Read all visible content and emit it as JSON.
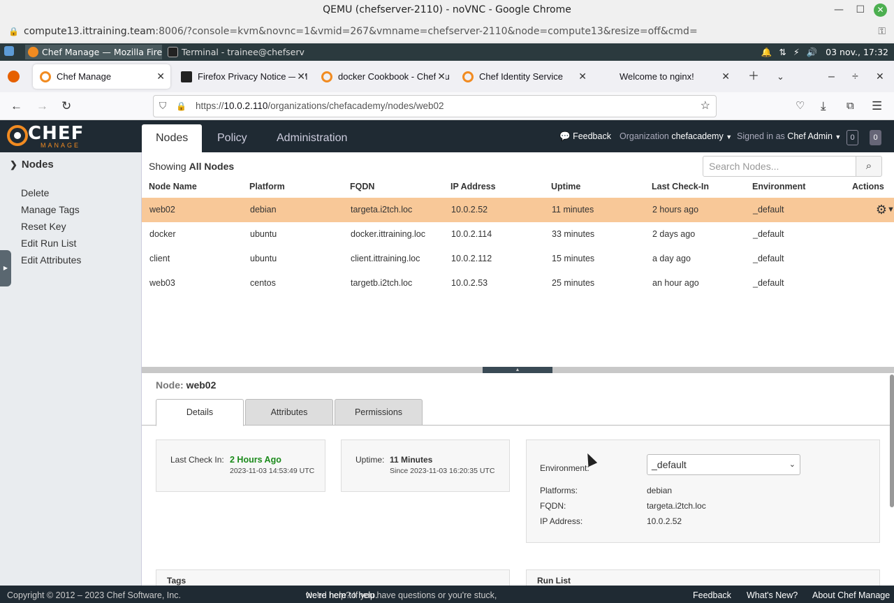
{
  "chrome": {
    "title": "QEMU (chefserver-2110) - noVNC - Google Chrome",
    "url_host": "compute13.ittraining.team",
    "url_rest": ":8006/?console=kvm&novnc=1&vmid=267&vmname=chefserver-2110&node=compute13&resize=off&cmd="
  },
  "taskbar": {
    "items": [
      "Chef Manage — Mozilla Firef...",
      "Terminal - trainee@chefserv..."
    ],
    "datetime": "03 nov., 17:32"
  },
  "firefox": {
    "tabs": [
      {
        "label": "Chef Manage",
        "color": "#f18b21"
      },
      {
        "label": "Firefox Privacy Notice — M",
        "color": "#222222"
      },
      {
        "label": "docker Cookbook - Chef Su",
        "color": "#f18b21"
      },
      {
        "label": "Chef Identity Service",
        "color": "#f18b21"
      },
      {
        "label": "Welcome to nginx!",
        "color": "#ffffff"
      }
    ],
    "url_prefix": "https://",
    "url_host": "10.0.2.110",
    "url_path": "/organizations/chefacademy/nodes/web02"
  },
  "header": {
    "logo_word": "CHEF",
    "logo_sub": "MANAGE",
    "nav": [
      "Nodes",
      "Policy",
      "Administration"
    ],
    "feedback": "Feedback",
    "org_label": "Organization",
    "org_value": "chefacademy",
    "signed_label": "Signed in as",
    "signed_value": "Chef Admin",
    "badge1": "0",
    "badge2": "0"
  },
  "sidebar": {
    "section": "Nodes",
    "actions": [
      "Delete",
      "Manage Tags",
      "Reset Key",
      "Edit Run List",
      "Edit Attributes"
    ]
  },
  "list": {
    "showing_prefix": "Showing",
    "showing_value": "All Nodes",
    "search_placeholder": "Search Nodes...",
    "columns": [
      "Node Name",
      "Platform",
      "FQDN",
      "IP Address",
      "Uptime",
      "Last Check-In",
      "Environment",
      "Actions"
    ],
    "rows": [
      [
        "web02",
        "debian",
        "targeta.i2tch.loc",
        "10.0.2.52",
        "11 minutes",
        "2 hours ago",
        "_default"
      ],
      [
        "docker",
        "ubuntu",
        "docker.ittraining.loc",
        "10.0.2.114",
        "33 minutes",
        "2 days ago",
        "_default"
      ],
      [
        "client",
        "ubuntu",
        "client.ittraining.loc",
        "10.0.2.112",
        "15 minutes",
        "a day ago",
        "_default"
      ],
      [
        "web03",
        "centos",
        "targetb.i2tch.loc",
        "10.0.2.53",
        "25 minutes",
        "an hour ago",
        "_default"
      ]
    ]
  },
  "detail": {
    "title_label": "Node:",
    "title_value": "web02",
    "tabs": [
      "Details",
      "Attributes",
      "Permissions"
    ],
    "last_checkin_label": "Last Check In:",
    "last_checkin_value": "2 Hours Ago",
    "last_checkin_time": "2023-11-03 14:53:49 UTC",
    "uptime_label": "Uptime:",
    "uptime_value": "11 Minutes",
    "uptime_since": "Since 2023-11-03 16:20:35 UTC",
    "environment_label": "Environment:",
    "environment_value": "_default",
    "platforms_label": "Platforms:",
    "platforms_value": "debian",
    "fqdn_label": "FQDN:",
    "fqdn_value": "targeta.i2tch.loc",
    "ip_label": "IP Address:",
    "ip_value": "10.0.2.52",
    "tags_title": "Tags",
    "runlist_title": "Run List"
  },
  "footer": {
    "copyright": "Copyright © 2012 – 2023 Chef Software, Inc.",
    "help_prefix": "Need help? If you have questions or you're stuck,",
    "help_link": "we're here to help.",
    "links": [
      "Feedback",
      "What's New?",
      "About Chef Manage"
    ]
  },
  "colors": {
    "accent": "#f18b21",
    "selected_row": "#f8c898",
    "header_bg": "#1f2a33"
  }
}
